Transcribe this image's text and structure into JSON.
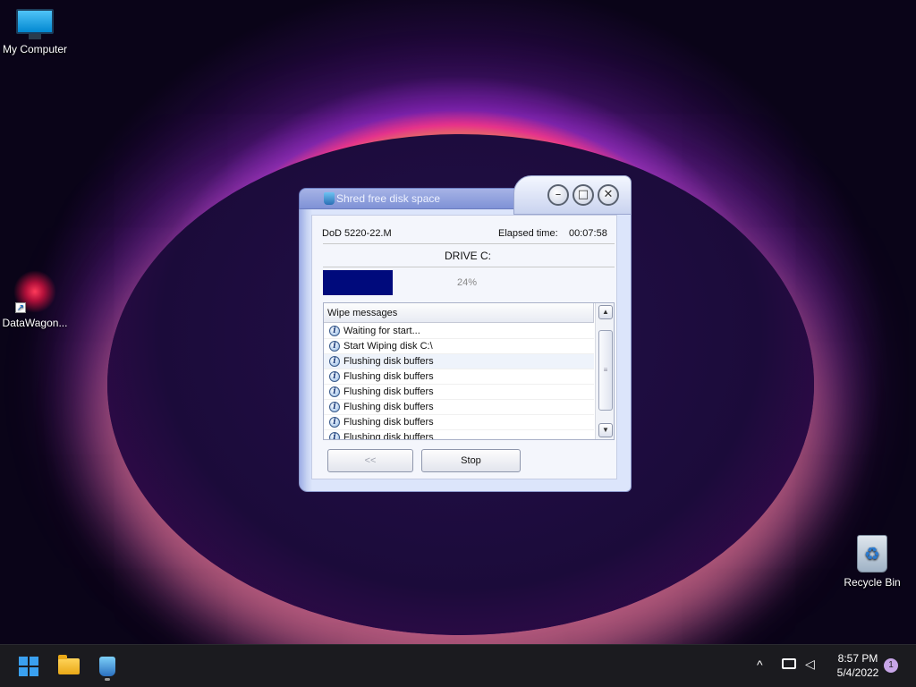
{
  "desktop": {
    "icons": [
      {
        "label": "My Computer"
      },
      {
        "label": "DataWagon..."
      },
      {
        "label": "Recycle Bin"
      }
    ]
  },
  "dialog": {
    "title": "Shred free disk space",
    "method": "DoD 5220-22.M",
    "elapsed_label": "Elapsed time:",
    "elapsed_value": "00:07:58",
    "drive": "DRIVE C:",
    "progress_percent": 24,
    "progress_text": "24%",
    "list_header": "Wipe messages",
    "messages": [
      "Waiting for start...",
      "Start Wiping disk C:\\",
      "Flushing disk buffers",
      "Flushing disk buffers",
      "Flushing disk buffers",
      "Flushing disk buffers",
      "Flushing disk buffers",
      "Flushing disk buffers"
    ],
    "back_button": "<<",
    "stop_button": "Stop"
  },
  "taskbar": {
    "time": "8:57 PM",
    "date": "5/4/2022",
    "notification_count": "1",
    "tray_chevron": "^"
  }
}
